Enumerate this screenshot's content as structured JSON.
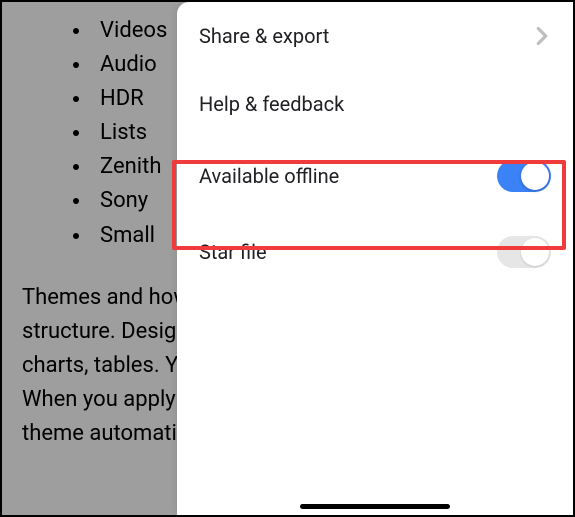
{
  "doc": {
    "bullets": [
      "Videos",
      "Audio",
      "HDR",
      "Lists",
      "Zenith",
      "Sony",
      "Small"
    ],
    "paragraph": "Themes and how they affect document content and structure. Design and layout with multiple pictures, charts, tables. You can change to match your style. When you apply styles, your headings match the new theme automatically."
  },
  "menu": {
    "share_export": "Share & export",
    "help_feedback": "Help & feedback",
    "available_offline": "Available offline",
    "star_file": "Star file"
  },
  "toggles": {
    "available_offline": true,
    "star_file": false
  }
}
